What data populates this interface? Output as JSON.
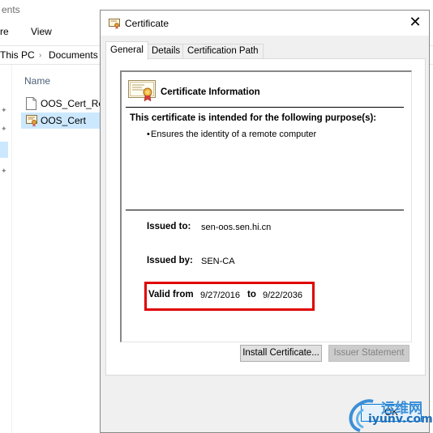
{
  "explorer": {
    "title_fragment": "ents",
    "ribbon": [
      "re",
      "View"
    ],
    "breadcrumb": [
      "This PC",
      "Documents"
    ],
    "column_header": "Name",
    "files": [
      {
        "name": "OOS_Cert_Req",
        "icon": "document-icon",
        "selected": false
      },
      {
        "name": "OOS_Cert",
        "icon": "certificate-file-icon",
        "selected": true
      }
    ]
  },
  "dialog": {
    "title": "Certificate",
    "close_glyph": "✕",
    "tabs": [
      "General",
      "Details",
      "Certification Path"
    ],
    "active_tab": "General",
    "info_heading": "Certificate Information",
    "purpose_heading": "This certificate is intended for the following purpose(s):",
    "purposes": [
      "Ensures the identity of a remote computer"
    ],
    "issued_to_label": "Issued to:",
    "issued_to_value": "sen-oos.sen.hi.cn",
    "issued_by_label": "Issued by:",
    "issued_by_value": "SEN-CA",
    "valid_from_label": "Valid from",
    "valid_from_value": "9/27/2016",
    "valid_to_label": "to",
    "valid_to_value": "9/22/2036",
    "install_button": "Install Certificate...",
    "issuer_statement_button": "Issuer Statement",
    "ok_button": "OK",
    "highlight_color": "#e00000"
  },
  "watermark": {
    "cn_text": "运维网",
    "url_text": "iyunv.com"
  }
}
